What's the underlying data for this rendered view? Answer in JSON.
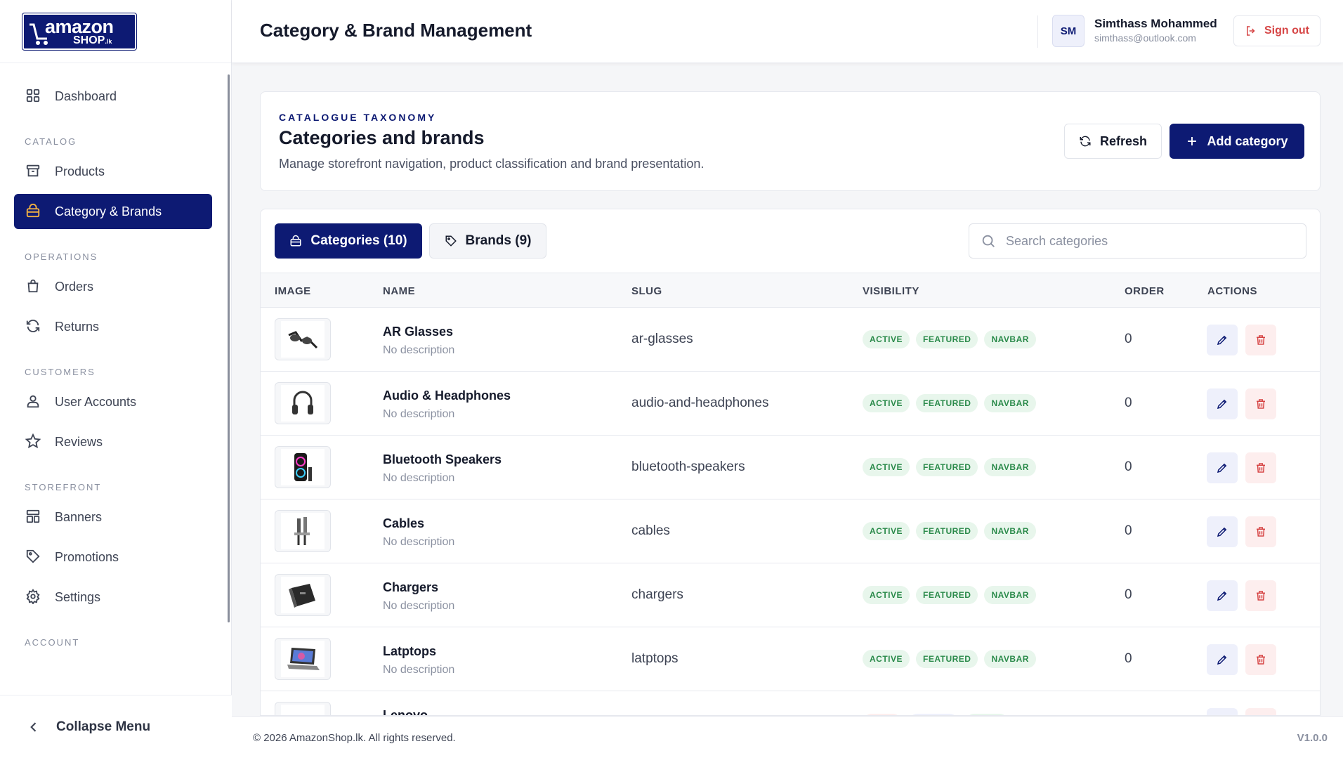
{
  "brand": {
    "logo_top": "amazon",
    "logo_bottom": "SHOP",
    "logo_suffix": ".lk"
  },
  "sidebar": {
    "dashboard": "Dashboard",
    "sections": {
      "catalog": "CATALOG",
      "operations": "OPERATIONS",
      "customers": "CUSTOMERS",
      "storefront": "STOREFRONT",
      "account": "ACCOUNT"
    },
    "items": {
      "products": "Products",
      "category_brands": "Category & Brands",
      "orders": "Orders",
      "returns": "Returns",
      "user_accounts": "User Accounts",
      "reviews": "Reviews",
      "banners": "Banners",
      "promotions": "Promotions",
      "settings": "Settings"
    },
    "collapse_label": "Collapse Menu"
  },
  "header": {
    "title": "Category & Brand Management",
    "avatar_initials": "SM",
    "user_name": "Simthass Mohammed",
    "user_email": "simthass@outlook.com",
    "signout_label": "Sign out"
  },
  "hero": {
    "eyebrow": "CATALOGUE TAXONOMY",
    "title": "Categories and brands",
    "subtitle": "Manage storefront navigation, product classification and brand presentation.",
    "refresh_label": "Refresh",
    "add_label": "Add category"
  },
  "tabs": {
    "categories": "Categories (10)",
    "brands": "Brands (9)"
  },
  "search": {
    "placeholder": "Search categories",
    "value": ""
  },
  "table": {
    "columns": {
      "image": "IMAGE",
      "name": "NAME",
      "slug": "SLUG",
      "visibility": "VISIBILITY",
      "order": "ORDER",
      "actions": "ACTIONS"
    },
    "rows": [
      {
        "name": "AR Glasses",
        "desc": "No description",
        "slug": "ar-glasses",
        "b1": "ACTIVE",
        "b2": "FEATURED",
        "b3": "NAVBAR",
        "order": "0"
      },
      {
        "name": "Audio & Headphones",
        "desc": "No description",
        "slug": "audio-and-headphones",
        "b1": "ACTIVE",
        "b2": "FEATURED",
        "b3": "NAVBAR",
        "order": "0"
      },
      {
        "name": "Bluetooth Speakers",
        "desc": "No description",
        "slug": "bluetooth-speakers",
        "b1": "ACTIVE",
        "b2": "FEATURED",
        "b3": "NAVBAR",
        "order": "0"
      },
      {
        "name": "Cables",
        "desc": "No description",
        "slug": "cables",
        "b1": "ACTIVE",
        "b2": "FEATURED",
        "b3": "NAVBAR",
        "order": "0"
      },
      {
        "name": "Chargers",
        "desc": "No description",
        "slug": "chargers",
        "b1": "ACTIVE",
        "b2": "FEATURED",
        "b3": "NAVBAR",
        "order": "0"
      },
      {
        "name": "Latptops",
        "desc": "No description",
        "slug": "latptops",
        "b1": "ACTIVE",
        "b2": "FEATURED",
        "b3": "NAVBAR",
        "order": "0"
      },
      {
        "name": "Lenovo",
        "desc": "",
        "slug": "",
        "b1": "",
        "b2": "",
        "b3": "",
        "order": ""
      }
    ]
  },
  "footer": {
    "copyright": "© 2026 AmazonShop.lk. All rights reserved.",
    "version": "V1.0.0"
  },
  "colors": {
    "primary": "#0d1a73",
    "accent": "#f5b342",
    "success_bg": "#e8f6ec",
    "success_text": "#2a8a4a",
    "danger": "#d64545"
  }
}
